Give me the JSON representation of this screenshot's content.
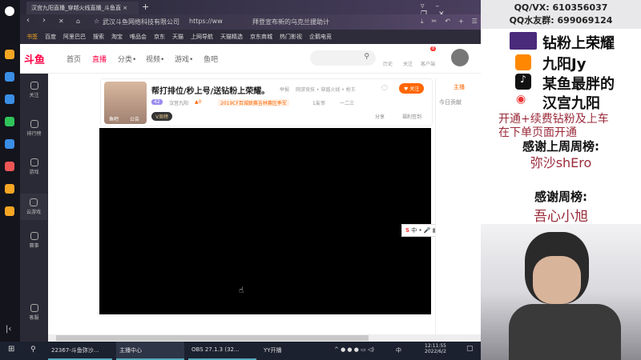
{
  "browser": {
    "tab_title": "汉宫九阳直播_穿越火线直播_斗鱼直",
    "site_label": "武汉斗鱼网络科技有限公司",
    "url": "https://ww",
    "news": "拜登宣布新的乌克兰援助计"
  },
  "bookmarks": [
    "书签",
    "百度",
    "阿里巴巴",
    "搜索",
    "淘宝",
    "唯品会",
    "京东",
    "天猫",
    "上网导航",
    "天猫精选",
    "京东商城",
    "热门影视",
    "企鹅电竞"
  ],
  "site": {
    "logo": "斗鱼",
    "nav": [
      "首页",
      "直播",
      "分类•",
      "视频•",
      "游戏•",
      "鱼吧"
    ],
    "icons": [
      "历史",
      "关注",
      "客户端"
    ],
    "badge": "8"
  },
  "sidebar": [
    "关注",
    "排行榜",
    "游戏",
    "云游戏",
    "赛事",
    "客服"
  ],
  "room": {
    "title": "帮打排位/秒上号/送钻粉上荣耀。",
    "report": "举报",
    "category": "网游竞技 • 穿越火线 • 枪王",
    "level": "42",
    "streamer": "汉宫九阳",
    "heat": "0",
    "honor": "2019CF百城联赛吉林赛区季军",
    "members": "1友邻",
    "tag": "一二三",
    "yubar": "鱼吧",
    "notice": "公告",
    "vip": "V周榜",
    "follow": "关注",
    "share": "分享",
    "sign": "福利签到"
  },
  "rpanel": {
    "tab": "主播",
    "today": "今日贡献"
  },
  "ime": "中",
  "taskbar": {
    "items": [
      "22367-斗鱼弥沙...",
      "主播中心",
      "OBS 27.1.3 (32...",
      "YY开播"
    ],
    "lang": "中",
    "time": "12:11:55",
    "date": "2022/6/2"
  },
  "overlay": {
    "qq": "QQ/VX: 610356037",
    "qqgroup": "QQ水友群: 699069124",
    "lines": [
      "钻粉上荣耀",
      "九阳Jy",
      "某鱼最胖的",
      "汉宫九阳"
    ],
    "notice1": "开通+续费钻粉及上车",
    "notice2": "在下单页面开通",
    "last_week": "感谢上周周榜:",
    "last_name": "弥沙shEro",
    "this_week": "感谢周榜:",
    "this_name": "吾心小旭"
  }
}
